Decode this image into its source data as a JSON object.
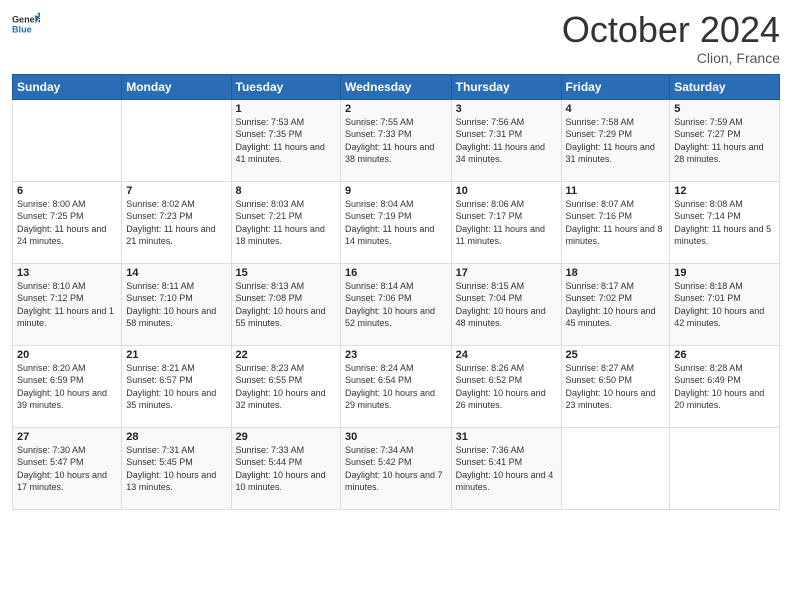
{
  "header": {
    "logo_general": "General",
    "logo_blue": "Blue",
    "month_title": "October 2024",
    "location": "Clion, France"
  },
  "days_of_week": [
    "Sunday",
    "Monday",
    "Tuesday",
    "Wednesday",
    "Thursday",
    "Friday",
    "Saturday"
  ],
  "weeks": [
    [
      {
        "day": "",
        "sunrise": "",
        "sunset": "",
        "daylight": ""
      },
      {
        "day": "",
        "sunrise": "",
        "sunset": "",
        "daylight": ""
      },
      {
        "day": "1",
        "sunrise": "Sunrise: 7:53 AM",
        "sunset": "Sunset: 7:35 PM",
        "daylight": "Daylight: 11 hours and 41 minutes."
      },
      {
        "day": "2",
        "sunrise": "Sunrise: 7:55 AM",
        "sunset": "Sunset: 7:33 PM",
        "daylight": "Daylight: 11 hours and 38 minutes."
      },
      {
        "day": "3",
        "sunrise": "Sunrise: 7:56 AM",
        "sunset": "Sunset: 7:31 PM",
        "daylight": "Daylight: 11 hours and 34 minutes."
      },
      {
        "day": "4",
        "sunrise": "Sunrise: 7:58 AM",
        "sunset": "Sunset: 7:29 PM",
        "daylight": "Daylight: 11 hours and 31 minutes."
      },
      {
        "day": "5",
        "sunrise": "Sunrise: 7:59 AM",
        "sunset": "Sunset: 7:27 PM",
        "daylight": "Daylight: 11 hours and 28 minutes."
      }
    ],
    [
      {
        "day": "6",
        "sunrise": "Sunrise: 8:00 AM",
        "sunset": "Sunset: 7:25 PM",
        "daylight": "Daylight: 11 hours and 24 minutes."
      },
      {
        "day": "7",
        "sunrise": "Sunrise: 8:02 AM",
        "sunset": "Sunset: 7:23 PM",
        "daylight": "Daylight: 11 hours and 21 minutes."
      },
      {
        "day": "8",
        "sunrise": "Sunrise: 8:03 AM",
        "sunset": "Sunset: 7:21 PM",
        "daylight": "Daylight: 11 hours and 18 minutes."
      },
      {
        "day": "9",
        "sunrise": "Sunrise: 8:04 AM",
        "sunset": "Sunset: 7:19 PM",
        "daylight": "Daylight: 11 hours and 14 minutes."
      },
      {
        "day": "10",
        "sunrise": "Sunrise: 8:06 AM",
        "sunset": "Sunset: 7:17 PM",
        "daylight": "Daylight: 11 hours and 11 minutes."
      },
      {
        "day": "11",
        "sunrise": "Sunrise: 8:07 AM",
        "sunset": "Sunset: 7:16 PM",
        "daylight": "Daylight: 11 hours and 8 minutes."
      },
      {
        "day": "12",
        "sunrise": "Sunrise: 8:08 AM",
        "sunset": "Sunset: 7:14 PM",
        "daylight": "Daylight: 11 hours and 5 minutes."
      }
    ],
    [
      {
        "day": "13",
        "sunrise": "Sunrise: 8:10 AM",
        "sunset": "Sunset: 7:12 PM",
        "daylight": "Daylight: 11 hours and 1 minute."
      },
      {
        "day": "14",
        "sunrise": "Sunrise: 8:11 AM",
        "sunset": "Sunset: 7:10 PM",
        "daylight": "Daylight: 10 hours and 58 minutes."
      },
      {
        "day": "15",
        "sunrise": "Sunrise: 8:13 AM",
        "sunset": "Sunset: 7:08 PM",
        "daylight": "Daylight: 10 hours and 55 minutes."
      },
      {
        "day": "16",
        "sunrise": "Sunrise: 8:14 AM",
        "sunset": "Sunset: 7:06 PM",
        "daylight": "Daylight: 10 hours and 52 minutes."
      },
      {
        "day": "17",
        "sunrise": "Sunrise: 8:15 AM",
        "sunset": "Sunset: 7:04 PM",
        "daylight": "Daylight: 10 hours and 48 minutes."
      },
      {
        "day": "18",
        "sunrise": "Sunrise: 8:17 AM",
        "sunset": "Sunset: 7:02 PM",
        "daylight": "Daylight: 10 hours and 45 minutes."
      },
      {
        "day": "19",
        "sunrise": "Sunrise: 8:18 AM",
        "sunset": "Sunset: 7:01 PM",
        "daylight": "Daylight: 10 hours and 42 minutes."
      }
    ],
    [
      {
        "day": "20",
        "sunrise": "Sunrise: 8:20 AM",
        "sunset": "Sunset: 6:59 PM",
        "daylight": "Daylight: 10 hours and 39 minutes."
      },
      {
        "day": "21",
        "sunrise": "Sunrise: 8:21 AM",
        "sunset": "Sunset: 6:57 PM",
        "daylight": "Daylight: 10 hours and 35 minutes."
      },
      {
        "day": "22",
        "sunrise": "Sunrise: 8:23 AM",
        "sunset": "Sunset: 6:55 PM",
        "daylight": "Daylight: 10 hours and 32 minutes."
      },
      {
        "day": "23",
        "sunrise": "Sunrise: 8:24 AM",
        "sunset": "Sunset: 6:54 PM",
        "daylight": "Daylight: 10 hours and 29 minutes."
      },
      {
        "day": "24",
        "sunrise": "Sunrise: 8:26 AM",
        "sunset": "Sunset: 6:52 PM",
        "daylight": "Daylight: 10 hours and 26 minutes."
      },
      {
        "day": "25",
        "sunrise": "Sunrise: 8:27 AM",
        "sunset": "Sunset: 6:50 PM",
        "daylight": "Daylight: 10 hours and 23 minutes."
      },
      {
        "day": "26",
        "sunrise": "Sunrise: 8:28 AM",
        "sunset": "Sunset: 6:49 PM",
        "daylight": "Daylight: 10 hours and 20 minutes."
      }
    ],
    [
      {
        "day": "27",
        "sunrise": "Sunrise: 7:30 AM",
        "sunset": "Sunset: 5:47 PM",
        "daylight": "Daylight: 10 hours and 17 minutes."
      },
      {
        "day": "28",
        "sunrise": "Sunrise: 7:31 AM",
        "sunset": "Sunset: 5:45 PM",
        "daylight": "Daylight: 10 hours and 13 minutes."
      },
      {
        "day": "29",
        "sunrise": "Sunrise: 7:33 AM",
        "sunset": "Sunset: 5:44 PM",
        "daylight": "Daylight: 10 hours and 10 minutes."
      },
      {
        "day": "30",
        "sunrise": "Sunrise: 7:34 AM",
        "sunset": "Sunset: 5:42 PM",
        "daylight": "Daylight: 10 hours and 7 minutes."
      },
      {
        "day": "31",
        "sunrise": "Sunrise: 7:36 AM",
        "sunset": "Sunset: 5:41 PM",
        "daylight": "Daylight: 10 hours and 4 minutes."
      },
      {
        "day": "",
        "sunrise": "",
        "sunset": "",
        "daylight": ""
      },
      {
        "day": "",
        "sunrise": "",
        "sunset": "",
        "daylight": ""
      }
    ]
  ]
}
